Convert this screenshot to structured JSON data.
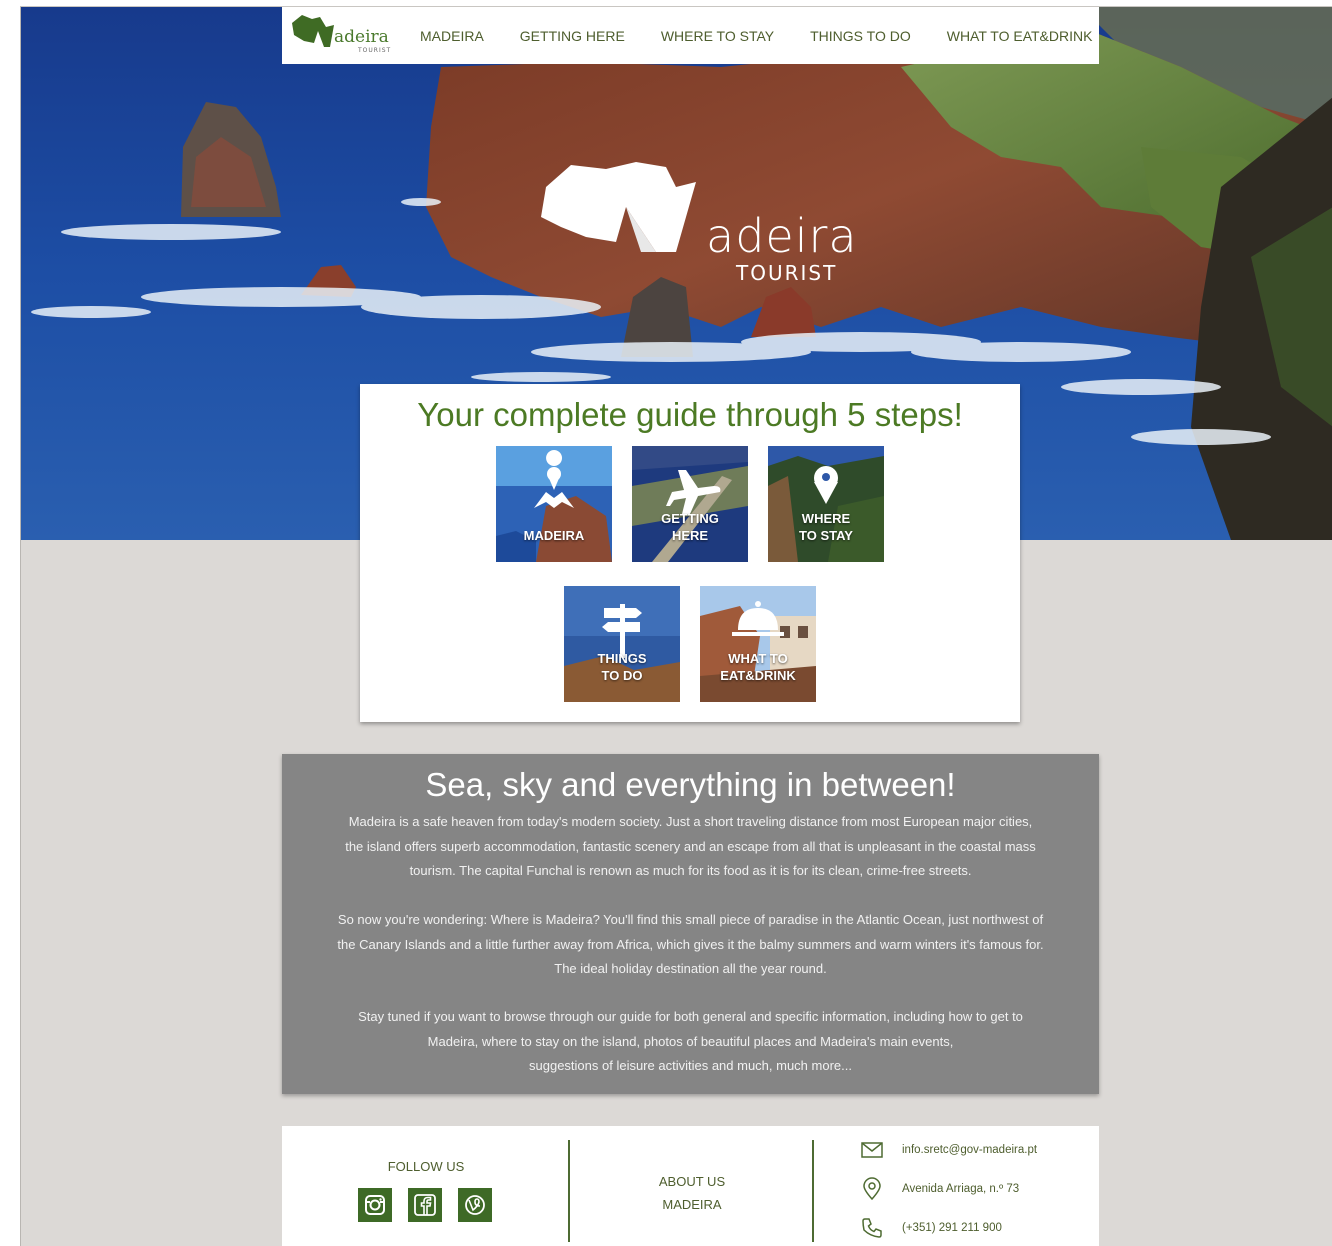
{
  "brand": {
    "name": "adeira",
    "initial": "M",
    "tagline": "TOURIST"
  },
  "nav": {
    "items": [
      {
        "label": "MADEIRA"
      },
      {
        "label": "GETTING HERE"
      },
      {
        "label": "WHERE TO STAY"
      },
      {
        "label": "THINGS TO DO"
      },
      {
        "label": "WHAT TO EAT&DRINK"
      }
    ]
  },
  "guide": {
    "title": "Your complete guide through 5 steps!",
    "tiles": [
      {
        "line1": "MADEIRA",
        "line2": "",
        "icon": "map-pin-icon"
      },
      {
        "line1": "GETTING",
        "line2": "HERE",
        "icon": "airplane-icon"
      },
      {
        "line1": "WHERE",
        "line2": "TO STAY",
        "icon": "location-pin-icon"
      },
      {
        "line1": "THINGS",
        "line2": "TO DO",
        "icon": "signpost-icon"
      },
      {
        "line1": "WHAT TO",
        "line2": "EAT&DRINK",
        "icon": "cloche-icon"
      }
    ]
  },
  "about": {
    "title": "Sea, sky and everything in between!",
    "paragraphs": [
      [
        "Madeira is a safe heaven from today's modern society. Just a short traveling distance from most European major cities,",
        "the island offers superb accommodation, fantastic scenery and an escape from all that is unpleasant in the coastal mass",
        "tourism. The capital Funchal is renown as much for its food as it is for its clean, crime-free streets."
      ],
      [
        "So now you're wondering: Where is Madeira? You'll find this small piece of paradise in the Atlantic Ocean, just northwest of",
        "the Canary Islands and a little further away from Africa, which gives it the balmy summers and warm winters it's famous for.",
        "The ideal holiday destination all the year round."
      ],
      [
        "Stay tuned if you want to browse through our guide for both general and specific information, including how to get to",
        "Madeira, where to stay on the island, photos of beautiful places and Madeira's main events,",
        "suggestions of leisure activities and much, much more..."
      ]
    ]
  },
  "footer": {
    "follow_label": "FOLLOW US",
    "social": [
      "instagram-icon",
      "facebook-icon",
      "vine-icon"
    ],
    "about_line1": "ABOUT US",
    "about_line2": "MADEIRA",
    "email": "info.sretc@gov-madeira.pt",
    "address": "Avenida Arriaga, n.º 73",
    "phone": "(+351) 291 211 900"
  },
  "colors": {
    "accent_green": "#4c7a24",
    "social_green": "#3e6a26",
    "about_bg": "#858585",
    "page_bg": "#dcd9d6"
  }
}
